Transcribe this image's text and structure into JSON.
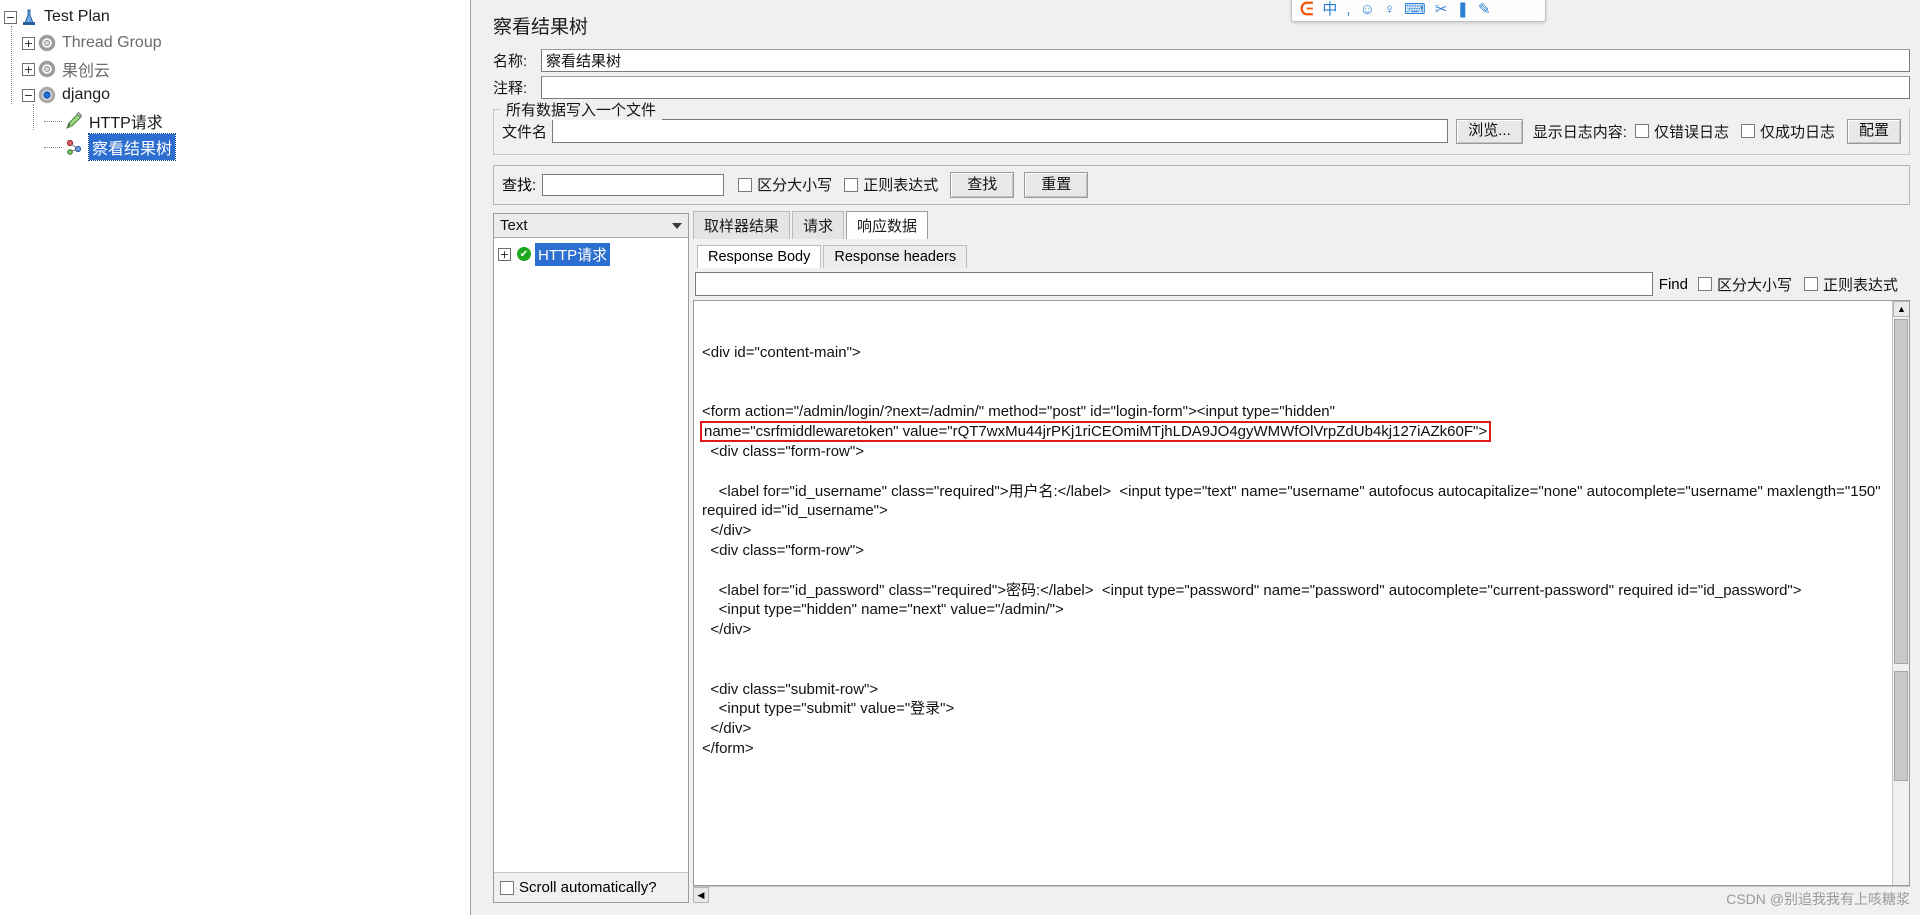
{
  "tree": {
    "items": [
      {
        "label": "Test Plan",
        "icon": "test-plan-icon",
        "toggle": "minus",
        "depth": 0,
        "selected": false,
        "dim": false
      },
      {
        "label": "Thread Group",
        "icon": "thread-group-icon",
        "toggle": "plus",
        "depth": 1,
        "selected": false,
        "dim": true
      },
      {
        "label": "果创云",
        "icon": "thread-group-icon",
        "toggle": "plus",
        "depth": 1,
        "selected": false,
        "dim": true
      },
      {
        "label": "django",
        "icon": "thread-group-active-icon",
        "toggle": "minus",
        "depth": 1,
        "selected": false,
        "dim": false
      },
      {
        "label": "HTTP请求",
        "icon": "http-request-icon",
        "toggle": "none",
        "depth": 2,
        "selected": false,
        "dim": false
      },
      {
        "label": "察看结果树",
        "icon": "view-results-tree-icon",
        "toggle": "none",
        "depth": 2,
        "selected": true,
        "dim": false
      }
    ]
  },
  "ime": {
    "logo": "sogou-logo-icon",
    "icons": [
      "中",
      ",",
      "☺",
      "♀",
      "⌨",
      "✂",
      "❚",
      "✎"
    ]
  },
  "panel": {
    "title": "察看结果树",
    "name_label": "名称:",
    "name_value": "察看结果树",
    "comment_label": "注释:",
    "comment_value": ""
  },
  "filegroup": {
    "legend": "所有数据写入一个文件",
    "filename_label": "文件名",
    "filename_value": "",
    "browse_button": "浏览...",
    "log_display_label": "显示日志内容:",
    "errors_only_label": "仅错误日志",
    "errors_only_checked": false,
    "success_only_label": "仅成功日志",
    "success_only_checked": false,
    "config_button": "配置"
  },
  "search": {
    "label": "查找:",
    "value": "",
    "case_sensitive_label": "区分大小写",
    "case_sensitive_checked": false,
    "regex_label": "正则表达式",
    "regex_checked": false,
    "find_button": "查找",
    "reset_button": "重置"
  },
  "results": {
    "render_combo_value": "Text",
    "sampler_label": "HTTP请求",
    "sampler_status": "success-check-icon",
    "scroll_auto_label": "Scroll automatically?",
    "scroll_auto_checked": false,
    "tabs": [
      {
        "label": "取样器结果",
        "active": false
      },
      {
        "label": "请求",
        "active": false
      },
      {
        "label": "响应数据",
        "active": true
      }
    ],
    "subtabs": [
      {
        "label": "Response Body",
        "active": true
      },
      {
        "label": "Response headers",
        "active": false
      }
    ],
    "find": {
      "value": "",
      "find_button": "Find",
      "case_sensitive_label": "区分大小写",
      "case_sensitive_checked": false,
      "regex_label": "正则表达式",
      "regex_checked": false
    },
    "response_lines": [
      {
        "text": "<div id=\"content-main\">",
        "indent": 0,
        "highlight": false
      },
      {
        "text": "",
        "indent": 0,
        "highlight": false
      },
      {
        "text": "",
        "indent": 0,
        "highlight": false
      },
      {
        "text": "<form action=\"/admin/login/?next=/admin/\" method=\"post\" id=\"login-form\"><input type=\"hidden\" ",
        "indent": 0,
        "highlight": false
      },
      {
        "text": "name=\"csrfmiddlewaretoken\" value=\"rQT7wxMu44jrPKj1riCEOmiMTjhLDA9JO4gyWMWfOlVrpZdUb4kj127iAZk60F\">",
        "indent": 0,
        "highlight": true
      },
      {
        "text": "  <div class=\"form-row\">",
        "indent": 0,
        "highlight": false
      },
      {
        "text": "",
        "indent": 0,
        "highlight": false
      },
      {
        "text": "    <label for=\"id_username\" class=\"required\">用户名:</label>  <input type=\"text\" name=\"username\" autofocus autocapitalize=\"none\" autocomplete=\"username\" maxlength=\"150\" required id=\"id_username\">",
        "indent": 0,
        "highlight": false
      },
      {
        "text": "  </div>",
        "indent": 0,
        "highlight": false
      },
      {
        "text": "  <div class=\"form-row\">",
        "indent": 0,
        "highlight": false
      },
      {
        "text": "",
        "indent": 0,
        "highlight": false
      },
      {
        "text": "    <label for=\"id_password\" class=\"required\">密码:</label>  <input type=\"password\" name=\"password\" autocomplete=\"current-password\" required id=\"id_password\">",
        "indent": 0,
        "highlight": false
      },
      {
        "text": "    <input type=\"hidden\" name=\"next\" value=\"/admin/\">",
        "indent": 0,
        "highlight": false
      },
      {
        "text": "  </div>",
        "indent": 0,
        "highlight": false
      },
      {
        "text": "",
        "indent": 0,
        "highlight": false
      },
      {
        "text": "",
        "indent": 0,
        "highlight": false
      },
      {
        "text": "  <div class=\"submit-row\">",
        "indent": 0,
        "highlight": false
      },
      {
        "text": "    <input type=\"submit\" value=\"登录\">",
        "indent": 0,
        "highlight": false
      },
      {
        "text": "  </div>",
        "indent": 0,
        "highlight": false
      },
      {
        "text": "</form>",
        "indent": 0,
        "highlight": false
      }
    ]
  },
  "watermark": "CSDN @别追我我有上咳糖浆"
}
